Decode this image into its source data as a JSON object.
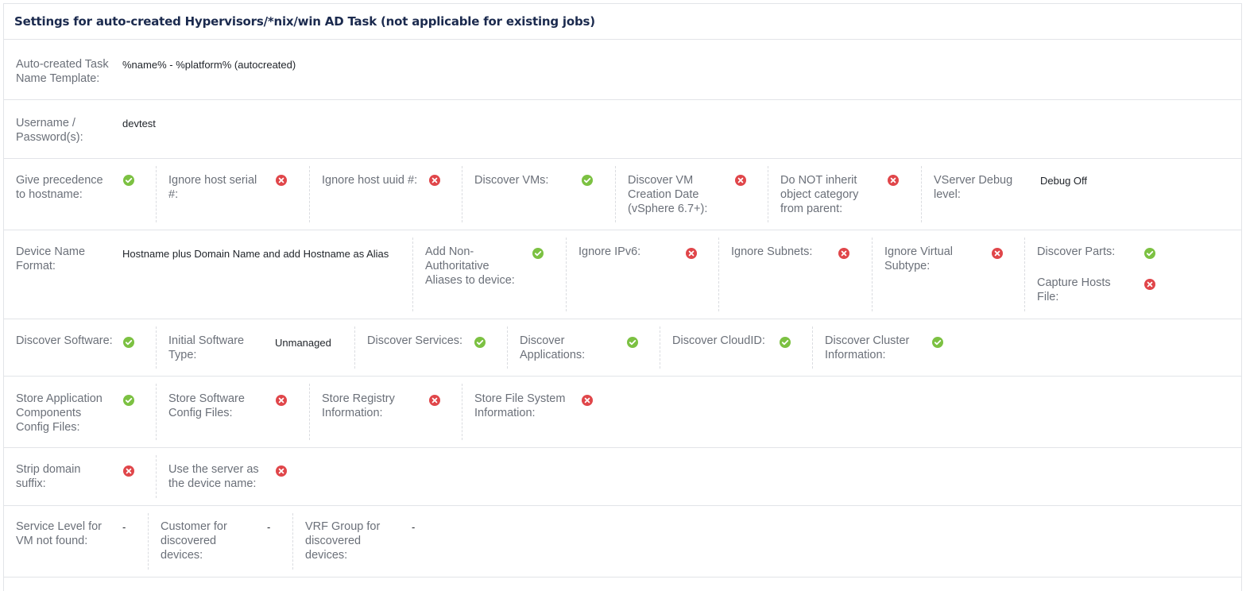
{
  "header": {
    "title": "Settings for auto-created Hypervisors/*nix/win AD Task (not applicable for existing jobs)"
  },
  "colors": {
    "check": "#7cc142",
    "cross": "#e0464a",
    "title": "#1b2a4e",
    "label": "#6b7079"
  },
  "row1": {
    "label": "Auto-created Task Name Template:",
    "value": "%name% - %platform% (autocreated)"
  },
  "row2": {
    "label": "Username / Password(s):",
    "value": "devtest"
  },
  "row3": {
    "precedence": "Give precedence to hostname:",
    "serial": "Ignore host serial #:",
    "uuid": "Ignore host uuid #:",
    "vms": "Discover VMs:",
    "vm_date": "Discover VM Creation Date (vSphere 6.7+):",
    "inherit": "Do NOT inherit object category from parent:",
    "debug_label": "VServer Debug level:",
    "debug_value": "Debug Off"
  },
  "row4": {
    "format_label": "Device Name Format:",
    "format_value": "Hostname plus Domain Name and add Hostname as Alias",
    "aliases": "Add Non-Authoritative Aliases to device:",
    "ipv6": "Ignore IPv6:",
    "subnets": "Ignore Subnets:",
    "virtual": "Ignore Virtual Subtype:",
    "parts": "Discover Parts:",
    "hosts": "Capture Hosts File:"
  },
  "row5": {
    "software": "Discover Software:",
    "sw_type_label": "Initial Software Type:",
    "sw_type_value": "Unmanaged",
    "services": "Discover Services:",
    "applications": "Discover Applications:",
    "cloudid": "Discover CloudID:",
    "cluster": "Discover Cluster Information:"
  },
  "row6": {
    "app_config": "Store Application Components Config Files:",
    "sw_config": "Store Software Config Files:",
    "registry": "Store Registry Information:",
    "filesystem": "Store File System Information:"
  },
  "row7": {
    "strip": "Strip domain suffix:",
    "server_name": "Use the server as the device name:"
  },
  "row8": {
    "service_level_label": "Service Level for VM not found:",
    "service_level_value": "-",
    "customer_label": "Customer for discovered devices:",
    "customer_value": "-",
    "vrf_label": "VRF Group for discovered devices:",
    "vrf_value": "-"
  },
  "icons": {
    "precedence": "check-circle-icon",
    "serial": "x-circle-icon",
    "uuid": "x-circle-icon",
    "vms": "check-circle-icon",
    "vm_date": "x-circle-icon",
    "inherit": "x-circle-icon",
    "aliases": "check-circle-icon",
    "ipv6": "x-circle-icon",
    "subnets": "x-circle-icon",
    "virtual": "x-circle-icon",
    "parts": "check-circle-icon",
    "hosts": "x-circle-icon",
    "software": "check-circle-icon",
    "services": "check-circle-icon",
    "applications": "check-circle-icon",
    "cloudid": "check-circle-icon",
    "cluster": "check-circle-icon",
    "app_config": "check-circle-icon",
    "sw_config": "x-circle-icon",
    "registry": "x-circle-icon",
    "filesystem": "x-circle-icon",
    "strip": "x-circle-icon",
    "server_name": "x-circle-icon"
  }
}
